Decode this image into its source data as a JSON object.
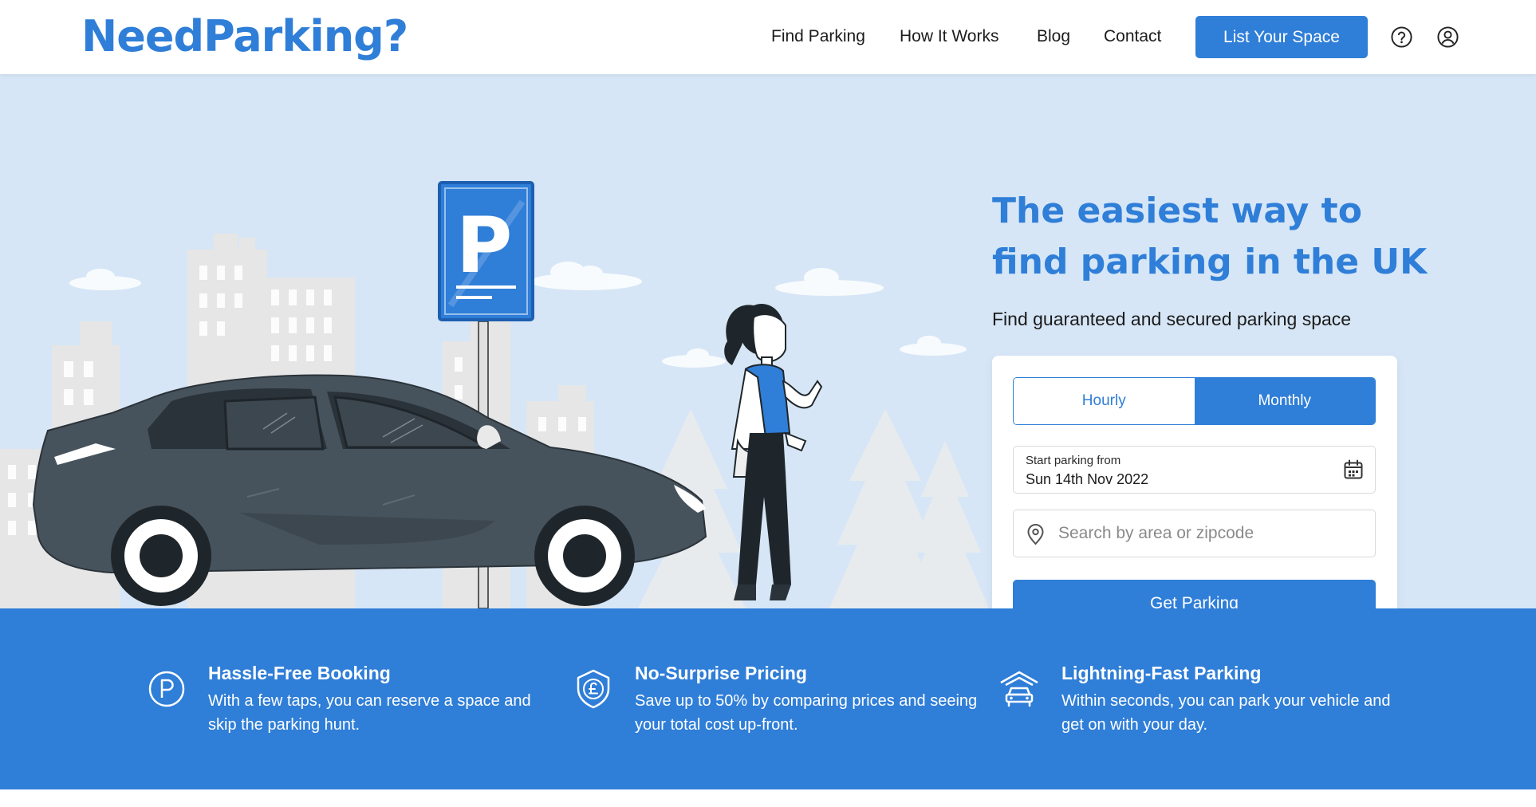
{
  "header": {
    "logo": "NeedParking?",
    "nav": [
      "Find Parking",
      "How It Works",
      "Blog",
      "Contact"
    ],
    "cta": "List Your Space",
    "icons": [
      "help-icon",
      "account-icon"
    ]
  },
  "hero": {
    "headline": "The easiest way to find parking in the UK",
    "subheadline": "Find guaranteed and secured parking space",
    "sign_letter": "P",
    "booking": {
      "tabs": [
        "Hourly",
        "Monthly"
      ],
      "selected_tab": "Monthly",
      "date_label": "Start parking from",
      "date_value": "Sun 14th Nov 2022",
      "search_placeholder": "Search by area or zipcode",
      "search_value": "",
      "submit": "Get Parking"
    }
  },
  "features": [
    {
      "icon": "parking-circle-icon",
      "title": "Hassle-Free Booking",
      "description": "With a few taps, you can reserve a space and skip the parking hunt."
    },
    {
      "icon": "pound-shield-icon",
      "title": "No-Surprise Pricing",
      "description": "Save up to 50% by comparing prices and seeing your total cost up-front."
    },
    {
      "icon": "car-garage-icon",
      "title": "Lightning-Fast Parking",
      "description": "Within seconds, you can park your vehicle and get on with your day."
    }
  ],
  "colors": {
    "brand_blue": "#2f7ed8",
    "hero_bg": "#d6e6f6",
    "car_body": "#47535c"
  }
}
